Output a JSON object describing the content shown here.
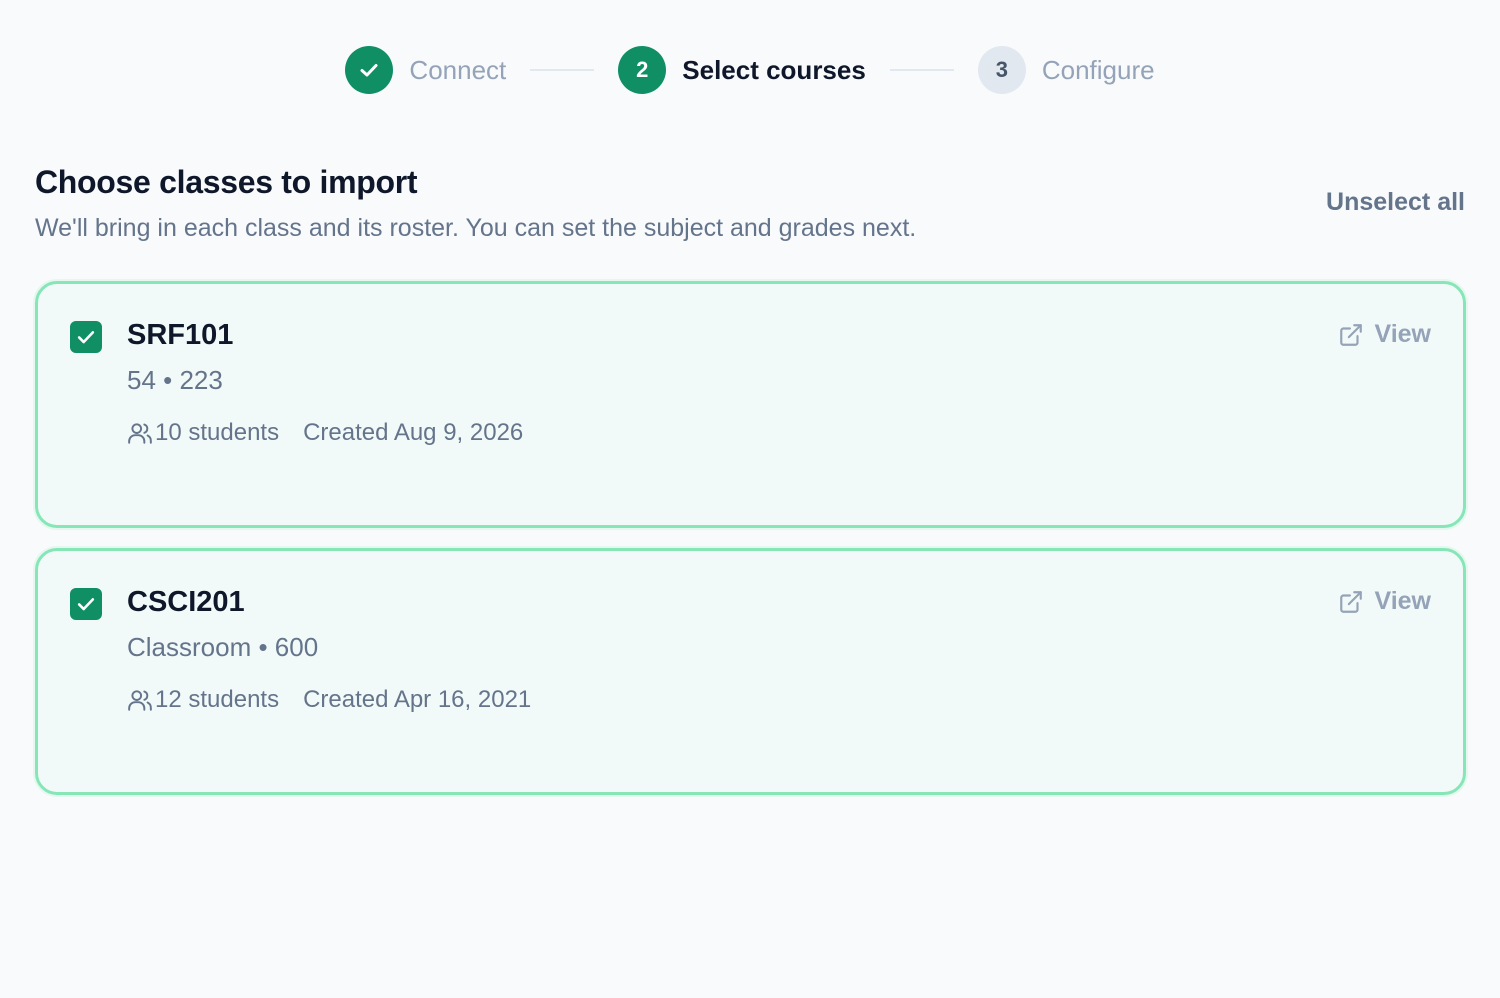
{
  "stepper": {
    "steps": [
      {
        "label": "Connect",
        "status": "done",
        "number": ""
      },
      {
        "label": "Select courses",
        "status": "active",
        "number": "2"
      },
      {
        "label": "Configure",
        "status": "pending",
        "number": "3"
      }
    ]
  },
  "header": {
    "title": "Choose classes to import",
    "subtitle": "We'll bring in each class and its roster. You can set the subject and grades next.",
    "unselect_all_label": "Unselect all"
  },
  "courses": [
    {
      "code": "SRF101",
      "meta": "54 • 223",
      "students": "10 students",
      "created": "Created Aug 9, 2026",
      "view_label": "View",
      "checked": true
    },
    {
      "code": "CSCI201",
      "meta": "Classroom • 600",
      "students": "12 students",
      "created": "Created Apr 16, 2021",
      "view_label": "View",
      "checked": true
    }
  ],
  "colors": {
    "accent": "#0f8f63",
    "card_border": "#86e6b8",
    "card_bg": "#f2faf9",
    "muted_text": "#64748b"
  }
}
